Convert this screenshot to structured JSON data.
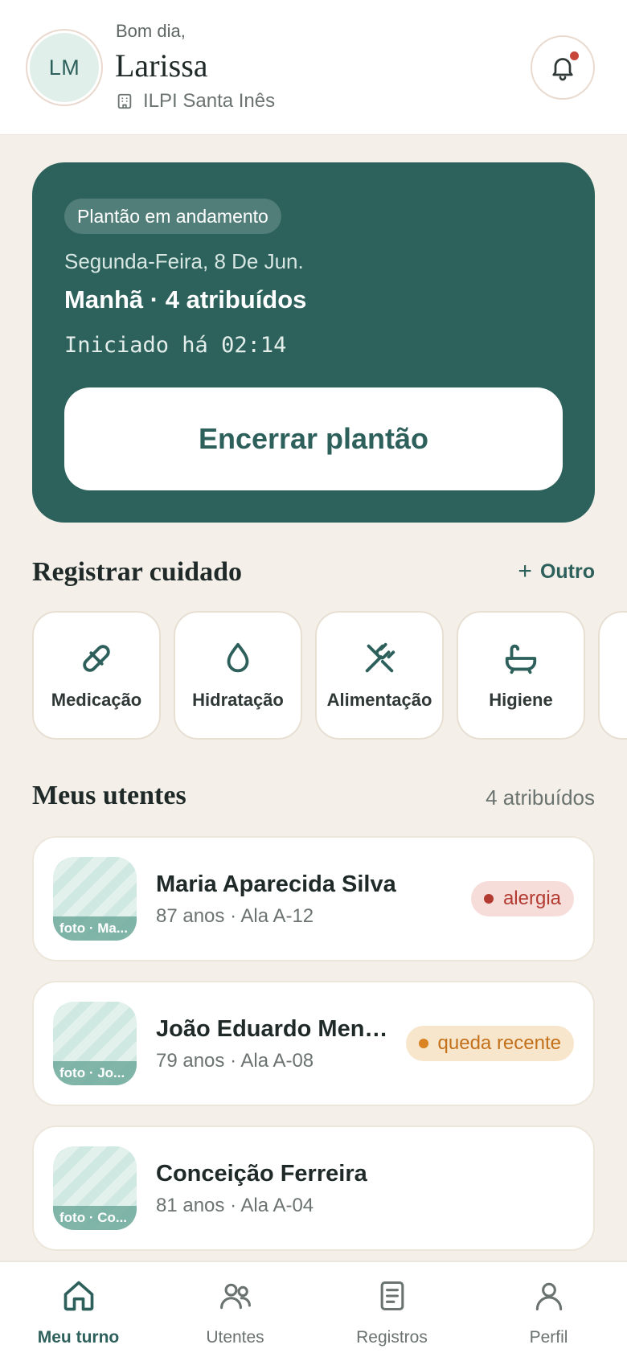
{
  "header": {
    "avatar_initials": "LM",
    "greeting": "Bom dia,",
    "user_name": "Larissa",
    "facility_icon": "building-icon",
    "facility": "ILPI Santa Inês",
    "notification_icon": "bell-icon",
    "has_unread": true
  },
  "shift": {
    "status": "Plantão em andamento",
    "date": "Segunda-Feira, 8 De Jun.",
    "summary": "Manhã · 4 atribuídos",
    "timer": "Iniciado há 02:14",
    "end_button": "Encerrar plantão"
  },
  "care": {
    "title": "Registrar cuidado",
    "add_other": "Outro",
    "items": [
      {
        "label": "Medicação",
        "icon": "pill-icon"
      },
      {
        "label": "Hidratação",
        "icon": "droplet-icon"
      },
      {
        "label": "Alimentação",
        "icon": "utensils-icon"
      },
      {
        "label": "Higiene",
        "icon": "bathtub-icon"
      }
    ]
  },
  "residents": {
    "title": "Meus utentes",
    "count": "4 atribuídos",
    "items": [
      {
        "name": "Maria Aparecida Silva",
        "meta": "87 anos · Ala A-12",
        "photo_caption": "foto · Ma...",
        "badge": "alergia",
        "badge_tone": "red"
      },
      {
        "name": "João Eduardo Mendes",
        "meta": "79 anos · Ala A-08",
        "photo_caption": "foto · Jo...",
        "badge": "queda recente",
        "badge_tone": "amber"
      },
      {
        "name": "Conceição Ferreira",
        "meta": "81 anos · Ala A-04",
        "photo_caption": "foto · Co...",
        "badge": "",
        "badge_tone": ""
      }
    ]
  },
  "nav": {
    "items": [
      {
        "label": "Meu turno",
        "icon": "home-icon",
        "active": true
      },
      {
        "label": "Utentes",
        "icon": "users-icon",
        "active": false
      },
      {
        "label": "Registros",
        "icon": "document-icon",
        "active": false
      },
      {
        "label": "Perfil",
        "icon": "user-icon",
        "active": false
      }
    ]
  },
  "colors": {
    "primary": "#2D625C",
    "background": "#F4F0E9",
    "alert_red": "#B23A30",
    "alert_amber": "#D98322"
  }
}
